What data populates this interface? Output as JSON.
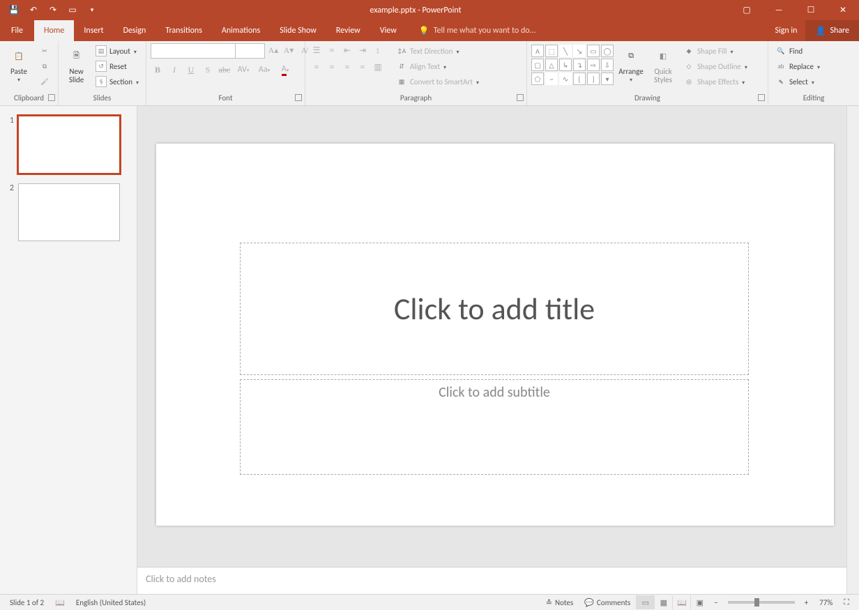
{
  "title": "example.pptx - PowerPoint",
  "tabs": {
    "file": "File",
    "home": "Home",
    "insert": "Insert",
    "design": "Design",
    "transitions": "Transitions",
    "animations": "Animations",
    "slideshow": "Slide Show",
    "review": "Review",
    "view": "View"
  },
  "tellme": "Tell me what you want to do...",
  "signin": "Sign in",
  "share": "Share",
  "groups": {
    "clipboard": "Clipboard",
    "slides": "Slides",
    "font": "Font",
    "paragraph": "Paragraph",
    "drawing": "Drawing",
    "editing": "Editing"
  },
  "clipboard": {
    "paste": "Paste"
  },
  "slides": {
    "newslide": "New\nSlide",
    "layout": "Layout",
    "reset": "Reset",
    "section": "Section"
  },
  "font": {
    "name": "",
    "size": "",
    "bold": "B",
    "italic": "I",
    "underline": "U",
    "shadow": "S",
    "strike": "abc",
    "spacing": "AV",
    "case": "Aa",
    "color": "A"
  },
  "paragraph": {
    "textdir": "Text Direction",
    "align": "Align Text",
    "smartart": "Convert to SmartArt"
  },
  "drawing": {
    "arrange": "Arrange",
    "quick": "Quick\nStyles",
    "fill": "Shape Fill",
    "outline": "Shape Outline",
    "effects": "Shape Effects"
  },
  "editing": {
    "find": "Find",
    "replace": "Replace",
    "select": "Select"
  },
  "thumbs": [
    {
      "num": "1",
      "selected": true
    },
    {
      "num": "2",
      "selected": false
    }
  ],
  "placeholders": {
    "title": "Click to add title",
    "subtitle": "Click to add subtitle"
  },
  "notes_placeholder": "Click to add notes",
  "status": {
    "slide": "Slide 1 of 2",
    "lang": "English (United States)",
    "notes": "Notes",
    "comments": "Comments",
    "zoom": "77%"
  }
}
